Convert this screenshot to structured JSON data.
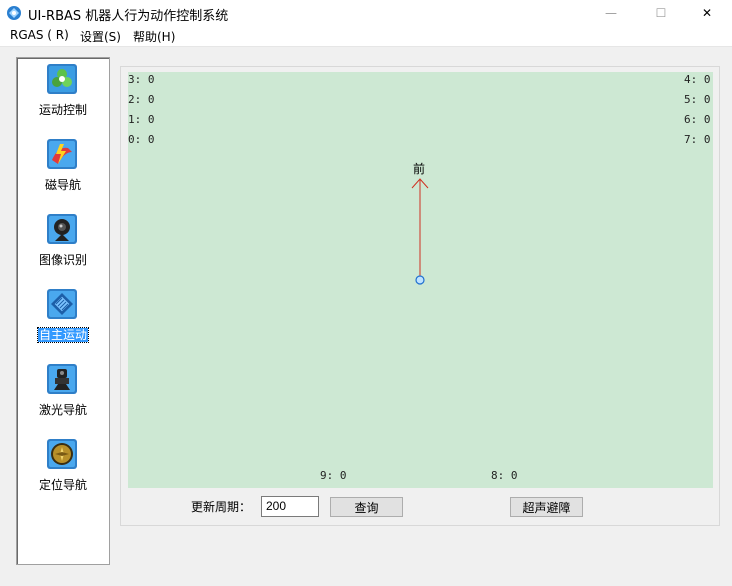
{
  "window": {
    "title": "UI-RBAS 机器人行为动作控制系统",
    "minimize": "—",
    "maximize": "☐",
    "close": "✕"
  },
  "menu": [
    "RGAS ( R)",
    "设置(S)",
    "帮助(H)"
  ],
  "sidebar": {
    "items": [
      {
        "label": "运动控制",
        "icon": "motion-control-icon"
      },
      {
        "label": "磁导航",
        "icon": "magnetic-navigation-icon"
      },
      {
        "label": "图像识别",
        "icon": "camera-icon"
      },
      {
        "label": "自主运动",
        "icon": "autonomous-motion-icon",
        "selected": true
      },
      {
        "label": "激光导航",
        "icon": "laser-navigation-icon"
      },
      {
        "label": "定位导航",
        "icon": "positioning-navigation-icon"
      }
    ]
  },
  "sensors": {
    "s3": "3: 0",
    "s2": "2: 0",
    "s1": "1: 0",
    "s0": "0: 0",
    "s4": "4: 0",
    "s5": "5: 0",
    "s6": "6: 0",
    "s7": "7: 0",
    "s9": "9: 0",
    "s8": "8: 0"
  },
  "direction_label": "前",
  "controls": {
    "period_label": "更新周期：",
    "period_value": "200",
    "query_button": "查询",
    "ultrasonic_button": "超声避障"
  },
  "colors": {
    "canvas": "#cde8d3",
    "arrow": "#d03020",
    "selection": "#3399ff"
  }
}
